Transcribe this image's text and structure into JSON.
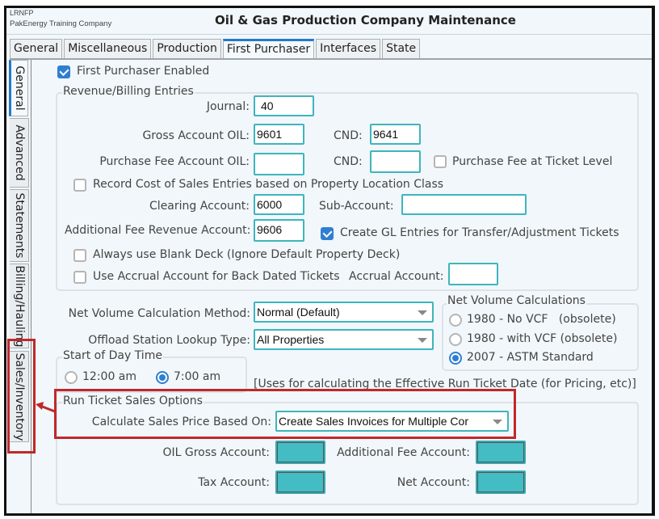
{
  "window": {
    "company_code": "LRNFP",
    "company_name": "PakEnergy Training Company",
    "title": "Oil & Gas Production Company Maintenance"
  },
  "top_tabs": [
    {
      "label": "General",
      "active": false
    },
    {
      "label": "Miscellaneous",
      "active": false
    },
    {
      "label": "Production",
      "active": false
    },
    {
      "label": "First Purchaser",
      "active": true
    },
    {
      "label": "Interfaces",
      "active": false
    },
    {
      "label": "State",
      "active": false
    }
  ],
  "side_tabs": [
    {
      "label": "General",
      "active": true
    },
    {
      "label": "Advanced",
      "active": false
    },
    {
      "label": "Statements",
      "active": false
    },
    {
      "label": "Billing/Hauling",
      "active": false
    },
    {
      "label": "Sales/Inventory",
      "active": false,
      "highlighted": true
    }
  ],
  "first_purchaser_enabled": {
    "label": "First Purchaser Enabled",
    "checked": true
  },
  "revenue_billing": {
    "legend": "Revenue/Billing Entries",
    "journal": {
      "label": "Journal:",
      "value": "40"
    },
    "gross_account_oil": {
      "label": "Gross Account OIL:",
      "value": "9601"
    },
    "gross_account_cnd": {
      "label": "CND:",
      "value": "9641"
    },
    "purchase_fee_oil": {
      "label": "Purchase Fee Account OIL:",
      "value": ""
    },
    "purchase_fee_cnd": {
      "label": "CND:",
      "value": ""
    },
    "purchase_fee_ticket_level": {
      "label": "Purchase Fee at Ticket Level",
      "checked": false
    },
    "record_cost_of_sales": {
      "label": "Record Cost of Sales Entries based on Property Location Class",
      "checked": false
    },
    "clearing_account": {
      "label": "Clearing Account:",
      "value": "6000"
    },
    "sub_account": {
      "label": "Sub-Account:",
      "value": ""
    },
    "additional_fee_revenue": {
      "label": "Additional Fee Revenue Account:",
      "value": "9606"
    },
    "create_gl_entries": {
      "label": "Create GL Entries for Transfer/Adjustment Tickets",
      "checked": true
    },
    "always_blank_deck": {
      "label": "Always use Blank Deck (Ignore Default Property Deck)",
      "checked": false
    },
    "use_accrual_account": {
      "label": "Use Accrual Account for Back Dated Tickets",
      "checked": false
    },
    "accrual_account": {
      "label": "Accrual Account:",
      "value": ""
    }
  },
  "net_volume_method": {
    "label": "Net Volume Calculation Method:",
    "value": "Normal (Default)"
  },
  "offload_station_lookup": {
    "label": "Offload Station Lookup Type:",
    "value": "All Properties"
  },
  "net_volume_calculations": {
    "legend": "Net Volume Calculations",
    "options": [
      {
        "label": "1980 - No VCF   (obsolete)",
        "checked": false
      },
      {
        "label": "1980 - with VCF (obsolete)",
        "checked": false
      },
      {
        "label": "2007 - ASTM Standard",
        "checked": true
      }
    ]
  },
  "start_of_day": {
    "legend": "Start of Day Time",
    "options": [
      {
        "label": "12:00 am",
        "checked": false
      },
      {
        "label": "7:00 am",
        "checked": true
      }
    ],
    "note": "[Uses for calculating the Effective Run Ticket Date (for Pricing, etc)]"
  },
  "run_ticket_sales": {
    "legend": "Run Ticket Sales Options",
    "calc_sales_price": {
      "label": "Calculate Sales Price Based On:",
      "value": "Create Sales Invoices for Multiple Cor"
    },
    "oil_gross_account": {
      "label": "OIL Gross Account:",
      "value": ""
    },
    "additional_fee_account": {
      "label": "Additional Fee Account:",
      "value": ""
    },
    "tax_account": {
      "label": "Tax Account:",
      "value": ""
    },
    "net_account": {
      "label": "Net Account:",
      "value": ""
    }
  },
  "colors": {
    "accent": "#2479c8",
    "field_border": "#3eb5bd",
    "field_fill_teal": "#43bcc3",
    "highlight_red": "#c0282a",
    "background": "#f1f7fb"
  }
}
